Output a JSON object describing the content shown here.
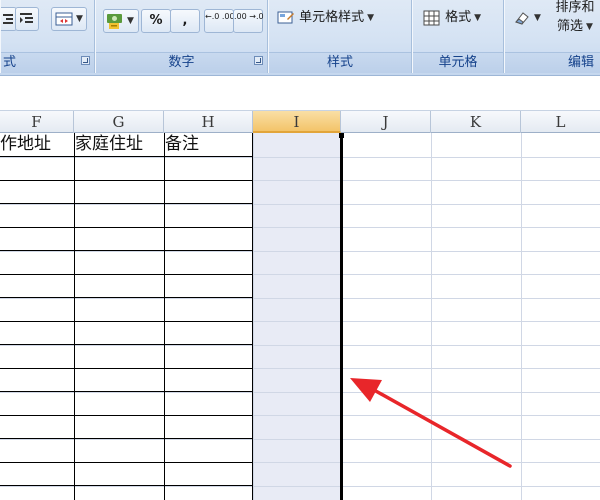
{
  "ribbon": {
    "groups": [
      {
        "name": "font",
        "label": "式"
      },
      {
        "name": "number",
        "label": "数字"
      },
      {
        "name": "styles",
        "label": "样式"
      },
      {
        "name": "cells",
        "label": "单元格"
      },
      {
        "name": "editing",
        "label": "编辑"
      }
    ],
    "number_percent": "%",
    "number_comma": ",",
    "increase_decimal": "←.0 .00",
    "decrease_decimal": ".00 →.0",
    "cell_styles_label": "单元格样式",
    "format_label": "格式",
    "sort_filter_line1": "排序和",
    "sort_filter_line2": "筛选"
  },
  "grid": {
    "columns": [
      "F",
      "G",
      "H",
      "I",
      "J",
      "K",
      "L"
    ],
    "selected_column": "I",
    "header_cells": {
      "F": "工作地址",
      "G": "家庭住址",
      "H": "备注"
    },
    "grid_color": "#d0d7e5",
    "table_border_color": "#000000",
    "selection_fill": "#e8ebf5"
  },
  "annotation": {
    "arrow_color": "#e8262a"
  }
}
